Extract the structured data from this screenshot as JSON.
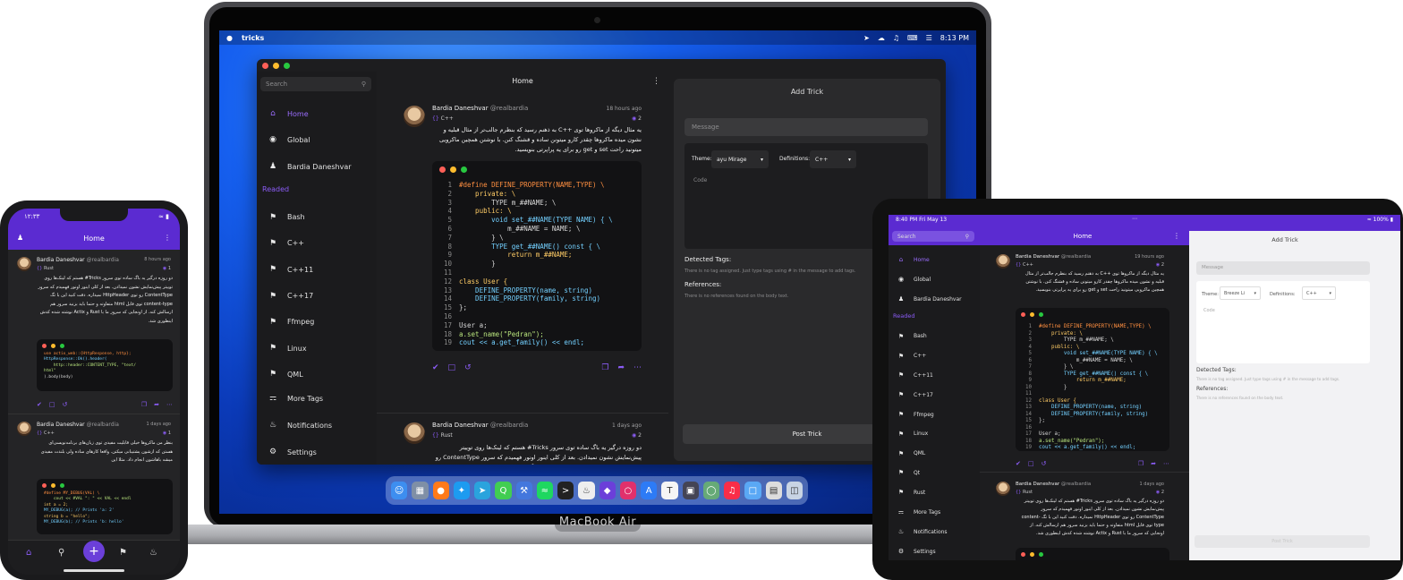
{
  "mac": {
    "menubar": {
      "app": "tricks",
      "time": "8:13 PM"
    },
    "label": "MacBook Air",
    "search_placeholder": "Search",
    "header_title": "Home",
    "sidebar": {
      "items": [
        {
          "label": "Home",
          "icon": "home-icon"
        },
        {
          "label": "Global",
          "icon": "globe-icon"
        },
        {
          "label": "Bardia Daneshvar",
          "icon": "person-icon"
        }
      ],
      "section": "Readed",
      "tags": [
        "Bash",
        "C++",
        "C++11",
        "C++17",
        "Ffmpeg",
        "Linux",
        "QML"
      ],
      "footer": [
        {
          "label": "More Tags",
          "icon": "tags-icon"
        },
        {
          "label": "Notifications",
          "icon": "bell-icon"
        },
        {
          "label": "Settings",
          "icon": "gear-icon"
        }
      ]
    },
    "posts": [
      {
        "name": "Bardia Daneshvar",
        "handle": "@realbardia",
        "time": "18 hours ago",
        "lang": "C++",
        "views": "2",
        "body": "یه مثال دیگه از ماکروها توی ++C به ذهنم رسید که بنظرم جالب‌تر از مثال قبلیه و نشون میده ماکروها چقدر کارو میتونن ساده و قشنگ کنن. با نوشتن همچین ماکرویی میتونید راحت set و get رو برای یه پراپرتی بنویسید."
      },
      {
        "name": "Bardia Daneshvar",
        "handle": "@realbardia",
        "time": "1 days ago",
        "lang": "Rust",
        "views": "2",
        "body": "دو روزه درگیر یه باگ ساده توی سرور Tricks# هستم که لینک‌ها روی توییتر پیش‌نمایش نشون نمیدادن. بعد از کلی اینور اونور فهمیدم که سرور ContentType رو توی HttpHeader نمیداره. دقت کنید این با تگ content-type توی فایل html متفاوته و حتما باید بزنید سرور هم ارسالش کنه. از اونجایی که سرور ما با Rust و Actix نوشته شده کدش اینطوری شد."
      }
    ],
    "code_lines": [
      "#define DEFINE_PROPERTY(NAME,TYPE) \\",
      "    private: \\",
      "        TYPE m_##NAME; \\",
      "    public: \\",
      "        void set_##NAME(TYPE NAME) { \\",
      "            m_##NAME = NAME; \\",
      "        } \\",
      "        TYPE get_##NAME() const { \\",
      "            return m_##NAME;",
      "        }",
      "",
      "class User {",
      "    DEFINE_PROPERTY(name, string)",
      "    DEFINE_PROPERTY(family, string)",
      "};",
      "",
      "User a;",
      "a.set_name(\"Pedran\");",
      "cout << a.get_family() << endl;"
    ],
    "add_trick": {
      "title": "Add Trick",
      "message_placeholder": "Message",
      "theme_label": "Theme:",
      "theme_value": "ayu Mirage",
      "definitions_label": "Definitions:",
      "definitions_value": "C++",
      "code_placeholder": "Code",
      "detected_tags_title": "Detected Tags:",
      "detected_tags_text": "There is no tag assigned. Just type tags using # in the message to add tags.",
      "references_title": "References:",
      "references_text": "There is no references found on the body text.",
      "post_button": "Post Trick"
    }
  },
  "phone": {
    "status_time": "۱۲:۳۳",
    "header_title": "Home",
    "posts": [
      {
        "name": "Bardia Daneshvar",
        "handle": "@realbardia",
        "time": "8 hours ago",
        "lang": "Rust",
        "views": "1",
        "body": "دو روزه درگیر یه باگ ساده توی سرور Tricks# هستم که لینک‌ها روی توییتر پیش‌نمایش نشون نمیدادن. بعد از کلی اینور اونور فهمیدم که سرور ContentType رو توی HttpHeader نمیداره. دقت کنید این با تگ content-type توی فایل html متفاوته و حتما باید بزنید سرور هم ارسالش کنه. از اونجایی که سرور ما با Rust و Actix نوشته شده کدش اینطوری شد."
      },
      {
        "name": "Bardia Daneshvar",
        "handle": "@realbardia",
        "time": "1 days ago",
        "lang": "C++",
        "views": "1",
        "body": "بنظر من ماکروها خیلی قابلیت مفیدی توی زبان‌های برنامه‌نویسی‌ای هستن که ازشون پشتیبانی میکنن. واقعا کارهای ساده ولی بلندت مفیدی میشه باهاشون انجام داد. مثلا این"
      }
    ],
    "code1": [
      "use actix_web::{HttpResponse, http};",
      "",
      "HttpResponse::Ok().header(",
      "    http::header::CONTENT_TYPE, \"text/",
      "html\"",
      ").body(body)"
    ],
    "code2": [
      "#define MY_DEBUG(VAL) \\",
      "    cout << #VAL \": \" << VAL << endl",
      "",
      "int a = 2;",
      "MY_DEBUG(a); // Prints 'a: 2'",
      "string b = \"hello\";",
      "MY_DEBUG(b); // Prints 'b: hello'"
    ]
  },
  "ipad": {
    "status_time": "8:40 PM",
    "status_date": "Fri May 13",
    "battery": "100%",
    "search_placeholder": "Search",
    "header_title": "Home",
    "sidebar": {
      "items": [
        {
          "label": "Home",
          "icon": "home-icon"
        },
        {
          "label": "Global",
          "icon": "globe-icon"
        },
        {
          "label": "Bardia Daneshvar",
          "icon": "person-icon"
        }
      ],
      "section": "Readed",
      "tags": [
        "Bash",
        "C++",
        "C++11",
        "C++17",
        "Ffmpeg",
        "Linux",
        "QML",
        "Qt",
        "Rust"
      ],
      "footer": [
        {
          "label": "More Tags",
          "icon": "tags-icon"
        },
        {
          "label": "Notifications",
          "icon": "bell-icon"
        },
        {
          "label": "Settings",
          "icon": "gear-icon"
        }
      ]
    },
    "posts": [
      {
        "name": "Bardia Daneshvar",
        "handle": "@realbardia",
        "time": "19 hours ago",
        "lang": "C++",
        "views": "2",
        "body": "یه مثال دیگه از ماکروها توی ++C به ذهنم رسید که بنظرم جالب‌تر از مثال قبلیه و نشون میده ماکروها چقدر کارو میتونن ساده و قشنگ کنن. با نوشتن همچین ماکرویی میتونید راحت set و get رو برای یه پراپرتی بنویسید."
      },
      {
        "name": "Bardia Daneshvar",
        "handle": "@realbardia",
        "time": "1 days ago",
        "lang": "Rust",
        "views": "2",
        "body": "دو روزه درگیر یه باگ ساده توی سرور Tricks# هستم که لینک‌ها روی توییتر پیش‌نمایش نشون نمیدادن. بعد از کلی اینور اونور فهمیدم که سرور ContentType رو توی HttpHeader نمیداره. دقت کنید این با تگ content-type توی فایل html متفاوته و حتما باید بزنید سرور هم ارسالش کنه. از اونجایی که سرور ما با Rust و Actix نوشته شده کدش اینطوری شد."
      }
    ],
    "add_trick": {
      "title": "Add Trick",
      "message_placeholder": "Message",
      "theme_label": "Theme:",
      "theme_value": "Breeze Li",
      "definitions_label": "Definitions:",
      "definitions_value": "C++",
      "code_placeholder": "Code",
      "detected_tags_title": "Detected Tags:",
      "detected_tags_text": "There is no tag assigned. Just type tags using # in the message to add tags.",
      "references_title": "References:",
      "references_text": "There is no references found on the body text.",
      "post_button": "Post Trick"
    }
  },
  "colors": {
    "accent": "#8b5cf6",
    "header_purple": "#5b2bd1"
  }
}
